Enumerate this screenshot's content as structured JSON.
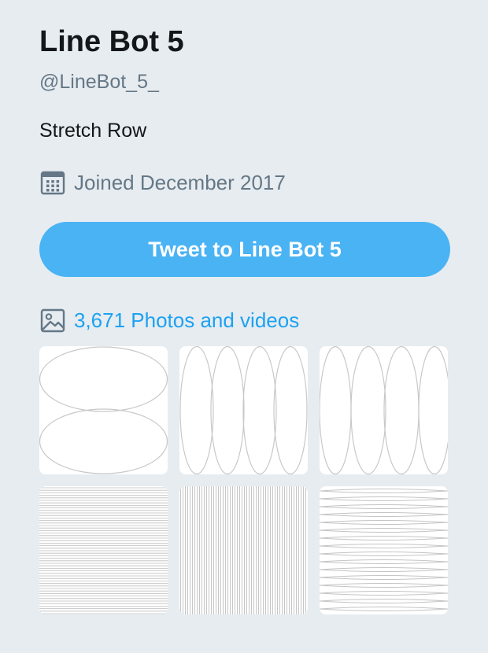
{
  "profile": {
    "name": "Line Bot 5",
    "handle": "@LineBot_5_",
    "bio": "Stretch Row",
    "joined": "Joined December 2017"
  },
  "actions": {
    "tweet_button_label": "Tweet to Line Bot 5"
  },
  "media": {
    "link_label": "3,671 Photos and videos",
    "thumbnails": [
      "two-stacked-ellipses",
      "four-vertical-ellipses",
      "four-vertical-ellipses-offset",
      "dense-horizontal-lines",
      "dense-vertical-lines",
      "horizontal-lens-lines"
    ]
  },
  "icons": {
    "calendar": "calendar-icon",
    "media": "image-icon"
  },
  "colors": {
    "background": "#e6ecf0",
    "button": "#4ab3f4",
    "link": "#1da1f2",
    "secondary_text": "#657786"
  }
}
